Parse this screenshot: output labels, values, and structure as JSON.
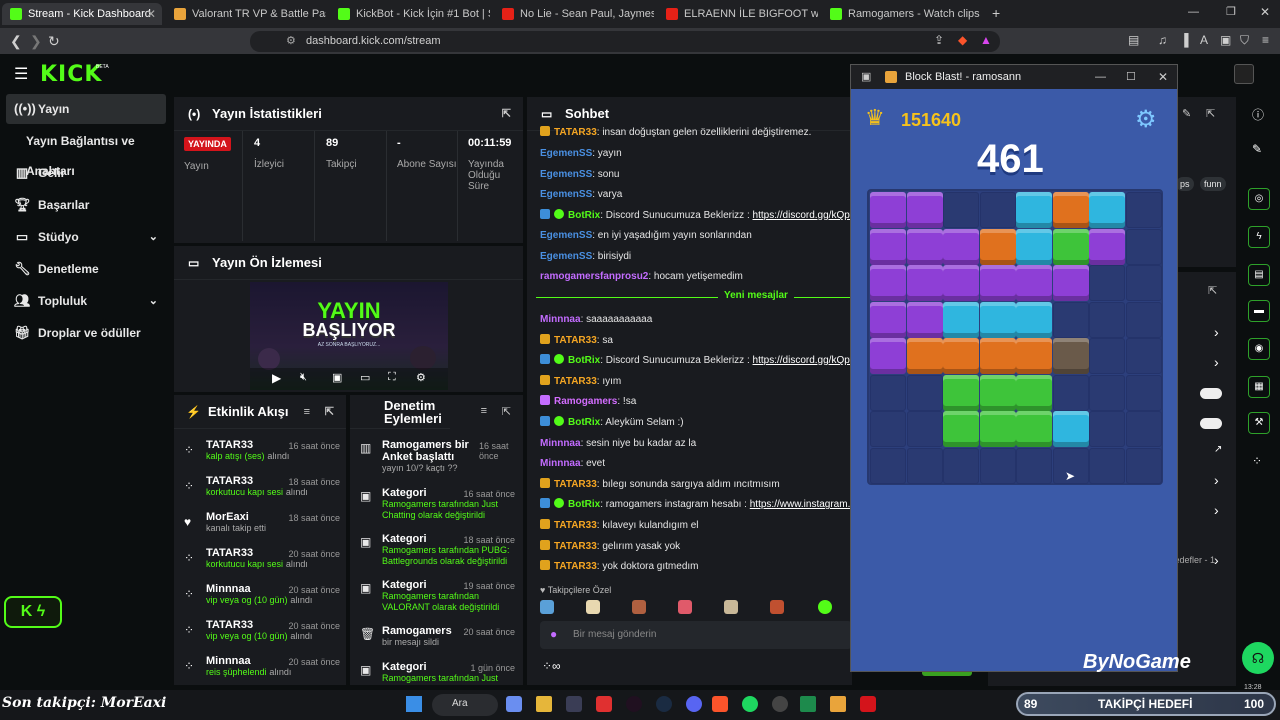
{
  "browser": {
    "tabs": [
      {
        "label": "Stream - Kick Dashboard",
        "color": "#53fc18"
      },
      {
        "label": "Valorant TR VP & Battle Pass Satın Al",
        "color": "#e8a33b"
      },
      {
        "label": "KickBot - Kick İçin #1 Bot | Sohbet, Bi",
        "color": "#53fc18"
      },
      {
        "label": "No Lie - Sean Paul, Jaymes Young",
        "color": "#e62117"
      },
      {
        "label": "ELRAENN İLE BIGFOOT w/LİMON TA",
        "color": "#e62117"
      },
      {
        "label": "Ramogamers - Watch clips on Kick",
        "color": "#53fc18"
      }
    ],
    "url": "dashboard.kick.com/stream"
  },
  "kick": {
    "logo": "KICK",
    "logo_beta": "BETA"
  },
  "sidebar": {
    "items": [
      {
        "label": "Yayın",
        "icon": "broadcast-icon"
      },
      {
        "label": "Yayın Bağlantısı ve Anahtarı",
        "icon": ""
      },
      {
        "label": "Gelir",
        "icon": "revenue-icon"
      },
      {
        "label": "Başarılar",
        "icon": "trophy-icon"
      },
      {
        "label": "Stüdyo",
        "icon": "studio-icon"
      },
      {
        "label": "Denetleme",
        "icon": "wrench-icon"
      },
      {
        "label": "Topluluk",
        "icon": "people-icon"
      },
      {
        "label": "Droplar ve ödüller",
        "icon": "gift-icon"
      }
    ]
  },
  "stats": {
    "title": "Yayın İstatistikleri",
    "live_badge": "YAYINDA",
    "live_label": "Yayın",
    "viewers_value": "4",
    "viewers_label": "İzleyici",
    "followers_value": "89",
    "followers_label": "Takipçi",
    "subs_value": "-",
    "subs_label": "Abone Sayısı",
    "time_value": "00:11:59",
    "time_label": "Yayında Olduğu Süre"
  },
  "preview": {
    "title": "Yayın Ön İzlemesi",
    "line1": "YAYIN",
    "line2": "BAŞLIYOR",
    "sub": "AZ SONRA BAŞLIYORUZ..."
  },
  "events": {
    "title": "Etkinlik Akışı",
    "items": [
      {
        "name": "TATAR33",
        "time": "16 saat önce",
        "detail": "kalp atışı (ses)",
        "suffix": "alındı"
      },
      {
        "name": "TATAR33",
        "time": "18 saat önce",
        "detail": "korkutucu kapı sesi",
        "suffix": "alındı"
      },
      {
        "name": "MorEaxi",
        "time": "18 saat önce",
        "detail": "",
        "suffix": "kanalı takip etti"
      },
      {
        "name": "TATAR33",
        "time": "20 saat önce",
        "detail": "korkutucu kapı sesi",
        "suffix": "alındı"
      },
      {
        "name": "Minnnaa",
        "time": "20 saat önce",
        "detail": "vip veya og (10 gün)",
        "suffix": "alındı"
      },
      {
        "name": "TATAR33",
        "time": "20 saat önce",
        "detail": "vip veya og (10 gün)",
        "suffix": "alındı"
      },
      {
        "name": "Minnnaa",
        "time": "20 saat önce",
        "detail": "reis şüphelendi",
        "suffix": "alındı"
      }
    ]
  },
  "mod": {
    "title": "Denetim Eylemleri",
    "items": [
      {
        "name": "Ramogamers bir Anket başlattı",
        "time": "16 saat önce",
        "detail": "yayın 10/? kaçtı ??"
      },
      {
        "name": "Kategori",
        "time": "16 saat önce",
        "detail": "Ramogamers tarafından Just Chatting olarak değiştirildi"
      },
      {
        "name": "Kategori",
        "time": "18 saat önce",
        "detail": "Ramogamers tarafından PUBG: Battlegrounds olarak değiştirildi"
      },
      {
        "name": "Kategori",
        "time": "19 saat önce",
        "detail": "Ramogamers tarafından VALORANT olarak değiştirildi"
      },
      {
        "name": "Ramogamers",
        "time": "20 saat önce",
        "detail": "bir mesajı sildi"
      },
      {
        "name": "Kategori",
        "time": "1 gün önce",
        "detail": "Ramogamers tarafından Just"
      }
    ]
  },
  "chat": {
    "title": "Sohbet",
    "new_messages": "Yeni mesajlar",
    "follower_only": "Takipçilere Özel",
    "input_placeholder": "Bir mesaj gönderin",
    "messages": [
      {
        "user": "TATAR33",
        "text": ": insan doğuştan gelen özelliklerini değiştiremez.",
        "cls": "u1"
      },
      {
        "user": "EgemenSS",
        "text": ": yayın",
        "cls": "u2"
      },
      {
        "user": "EgemenSS",
        "text": ": sonu",
        "cls": "u2"
      },
      {
        "user": "EgemenSS",
        "text": ": varya",
        "cls": "u2"
      },
      {
        "user": "BotRix",
        "text": ": Discord Sunucumuza Beklerizz : ",
        "link": "https://discord.gg/kQpfFHat",
        "cls": "u4"
      },
      {
        "user": "EgemenSS",
        "text": ": en iyi yaşadığım yayın sonlarından",
        "cls": "u2"
      },
      {
        "user": "EgemenSS",
        "text": ": birisiydi",
        "cls": "u2"
      },
      {
        "user": "ramogamersfanprosu2",
        "text": ": hocam yetişemedim",
        "cls": "u3"
      },
      {
        "user": "Minnnaa",
        "text": ": saaaaaaaaaaa",
        "cls": "u3"
      },
      {
        "user": "TATAR33",
        "text": ": sa",
        "cls": "u1"
      },
      {
        "user": "BotRix",
        "text": ": Discord Sunucumuza Beklerizz : ",
        "link": "https://discord.gg/kQpfFHat",
        "cls": "u4"
      },
      {
        "user": "TATAR33",
        "text": ": ıyım",
        "cls": "u1"
      },
      {
        "user": "Ramogamers",
        "text": ": !sa",
        "cls": "u5"
      },
      {
        "user": "BotRix",
        "text": ": Aleyküm Selam :)",
        "cls": "u4"
      },
      {
        "user": "Minnnaa",
        "text": ": sesin niye bu kadar az la",
        "cls": "u3"
      },
      {
        "user": "Minnnaa",
        "text": ": evet",
        "cls": "u3"
      },
      {
        "user": "TATAR33",
        "text": ": bılegı sonunda sargıya aldım ıncıtmısım",
        "cls": "u1"
      },
      {
        "user": "BotRix",
        "text": ": ramogamers instagram hesabı : ",
        "link": "https://www.instagram.com/r",
        "cls": "u4"
      },
      {
        "user": "TATAR33",
        "text": ": kılaveyı kulandıgım el",
        "cls": "u1"
      },
      {
        "user": "TATAR33",
        "text": ": gelırım yasak yok",
        "cls": "u1"
      },
      {
        "user": "TATAR33",
        "text": ": yok doktora gıtmedım",
        "cls": "u1"
      }
    ]
  },
  "game": {
    "window_title": "Block Blast! - ramosann",
    "best_score": "151640",
    "score": "461",
    "brand": "ByNoGame"
  },
  "side_tags": {
    "tag1": "ps",
    "tag2": "funn",
    "goal_text": "Hedefler - 1"
  },
  "overlay": {
    "last_follower": "Son takipçi: MorEaxi",
    "goal_current": "89",
    "goal_label": "TAKİPÇİ HEDEFİ",
    "goal_target": "100",
    "taskbar_search": "Ara",
    "time": "13:28"
  }
}
